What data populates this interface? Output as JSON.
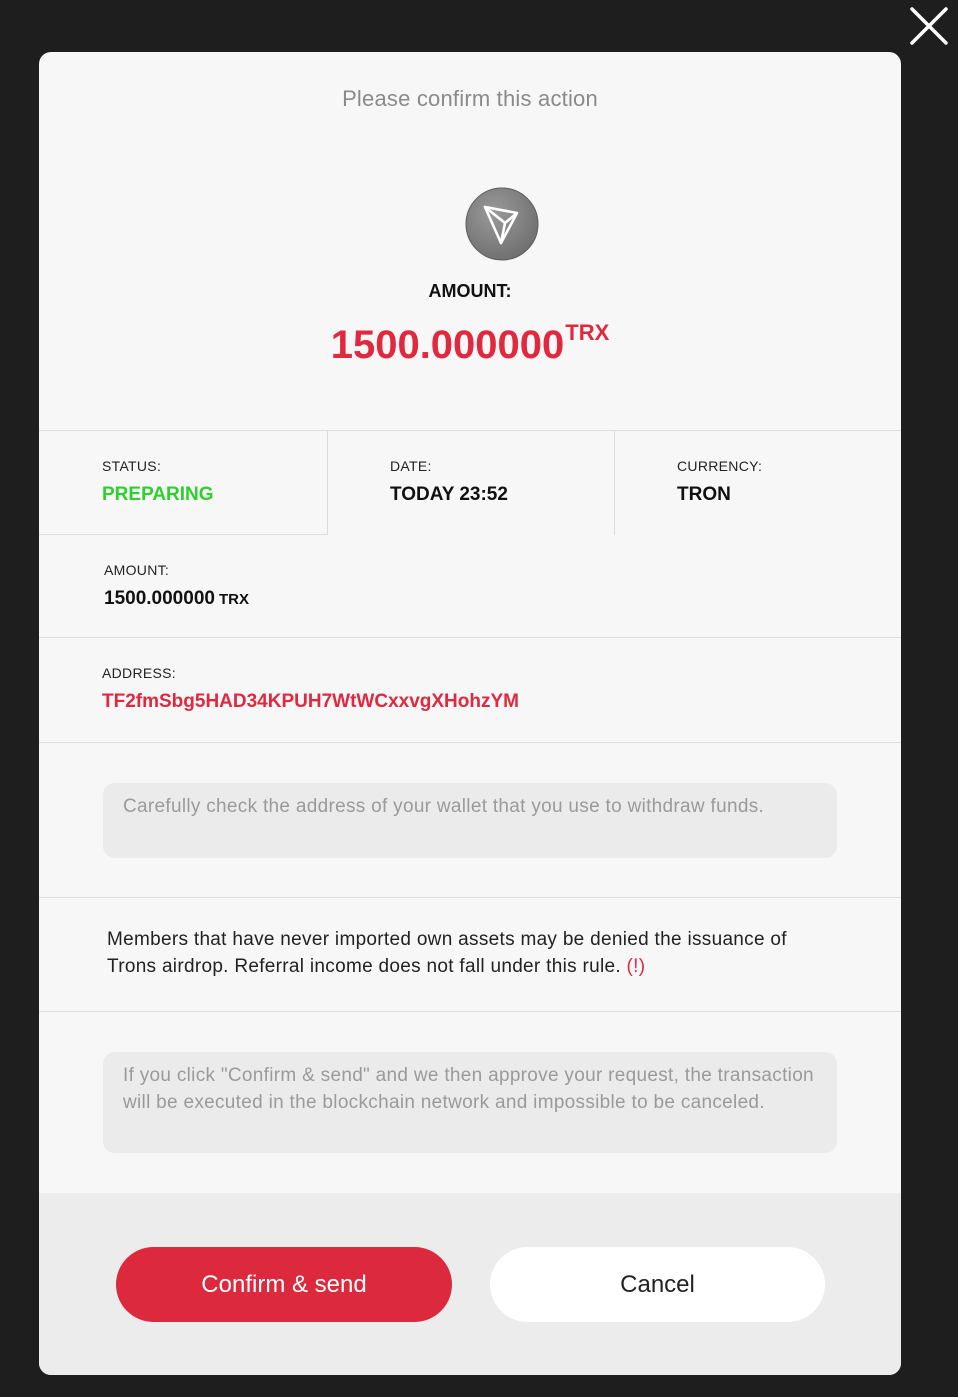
{
  "modal": {
    "title": "Please confirm this action",
    "coin_icon": "tron-logo-icon",
    "amount_label": "AMOUNT:",
    "amount_value": "1500.000000",
    "amount_unit": "TRX"
  },
  "details": {
    "status": {
      "label": "STATUS:",
      "value": "PREPARING",
      "color": "#2fcf2f"
    },
    "date": {
      "label": "DATE:",
      "value": "TODAY 23:52"
    },
    "currency": {
      "label": "CURRENCY:",
      "value": "TRON"
    },
    "amount": {
      "label": "AMOUNT:",
      "value": "1500.000000",
      "unit": "TRX"
    },
    "address": {
      "label": "ADDRESS:",
      "value": "TF2fmSbg5HAD34KPUH7WtWCxxvgXHohzYM",
      "color": "#e0283f"
    }
  },
  "notes": {
    "wallet_check": "Carefully check the address of your wallet that you use to withdraw funds.",
    "airdrop": "Members that have never imported own assets may be denied the issuance of Trons airdrop. Referral income does not fall under this rule.",
    "airdrop_warning": "(!)",
    "irreversible": "If you click \"Confirm & send\" and we then approve your request, the transaction will be executed in the blockchain network and impossible to be canceled."
  },
  "actions": {
    "confirm_label": "Confirm & send",
    "cancel_label": "Cancel"
  },
  "colors": {
    "accent": "#dc293e",
    "status_green": "#2fcf2f",
    "overlay": "#1e1e1e"
  }
}
